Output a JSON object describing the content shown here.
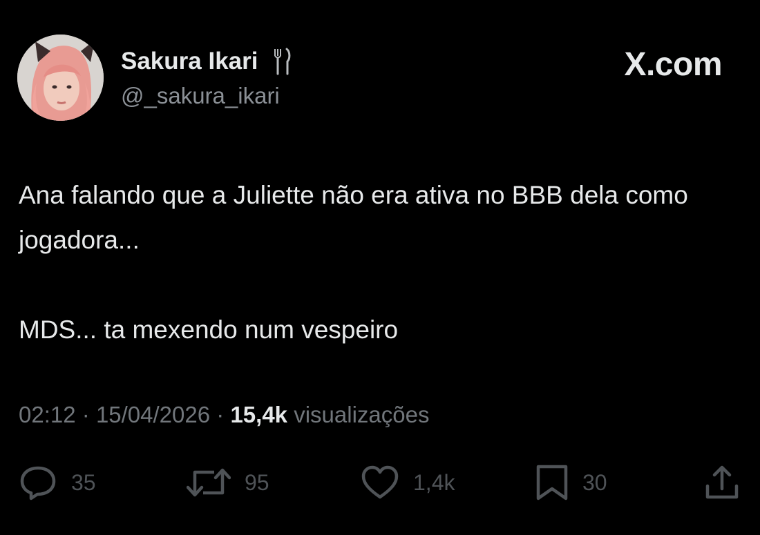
{
  "author": {
    "name": "Sakura Ikari",
    "handle": "@_sakura_ikari",
    "name_emoji_icon": "fork-and-knife-icon"
  },
  "brand": "X.com",
  "tweet": {
    "paragraphs": [
      "Ana falando que a Juliette não era ativa no BBB dela como jogadora...",
      "MDS... ta mexendo num vespeiro"
    ]
  },
  "meta": {
    "time": "02:12",
    "separator": "·",
    "date": "15/04/2026",
    "views_count": "15,4k",
    "views_label": "visualizações"
  },
  "actions": {
    "replies": "35",
    "reposts": "95",
    "likes": "1,4k",
    "bookmarks": "30"
  },
  "colors": {
    "background": "#000000",
    "primary_text": "#e7e9ea",
    "secondary_text": "#71767b",
    "action_icons": "#4f5357"
  }
}
